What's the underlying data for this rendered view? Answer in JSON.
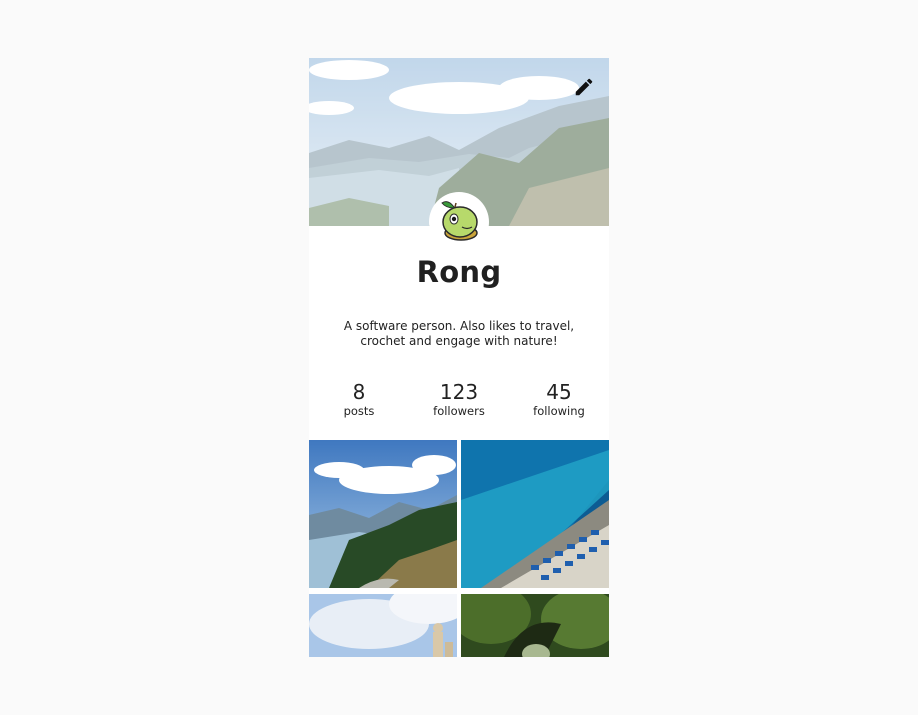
{
  "profile": {
    "name": "Rong",
    "bio": "A software person. Also likes to travel, crochet and engage with nature!",
    "avatar_icon": "turtle-avatar-icon",
    "edit_icon": "pencil-icon"
  },
  "stats": [
    {
      "value": "8",
      "label": "posts"
    },
    {
      "value": "123",
      "label": "followers"
    },
    {
      "value": "45",
      "label": "following"
    }
  ],
  "photos": [
    {
      "name": "photo-mountain-lake"
    },
    {
      "name": "photo-beach-umbrellas"
    },
    {
      "name": "photo-sky-statues"
    },
    {
      "name": "photo-forest-tree"
    }
  ]
}
